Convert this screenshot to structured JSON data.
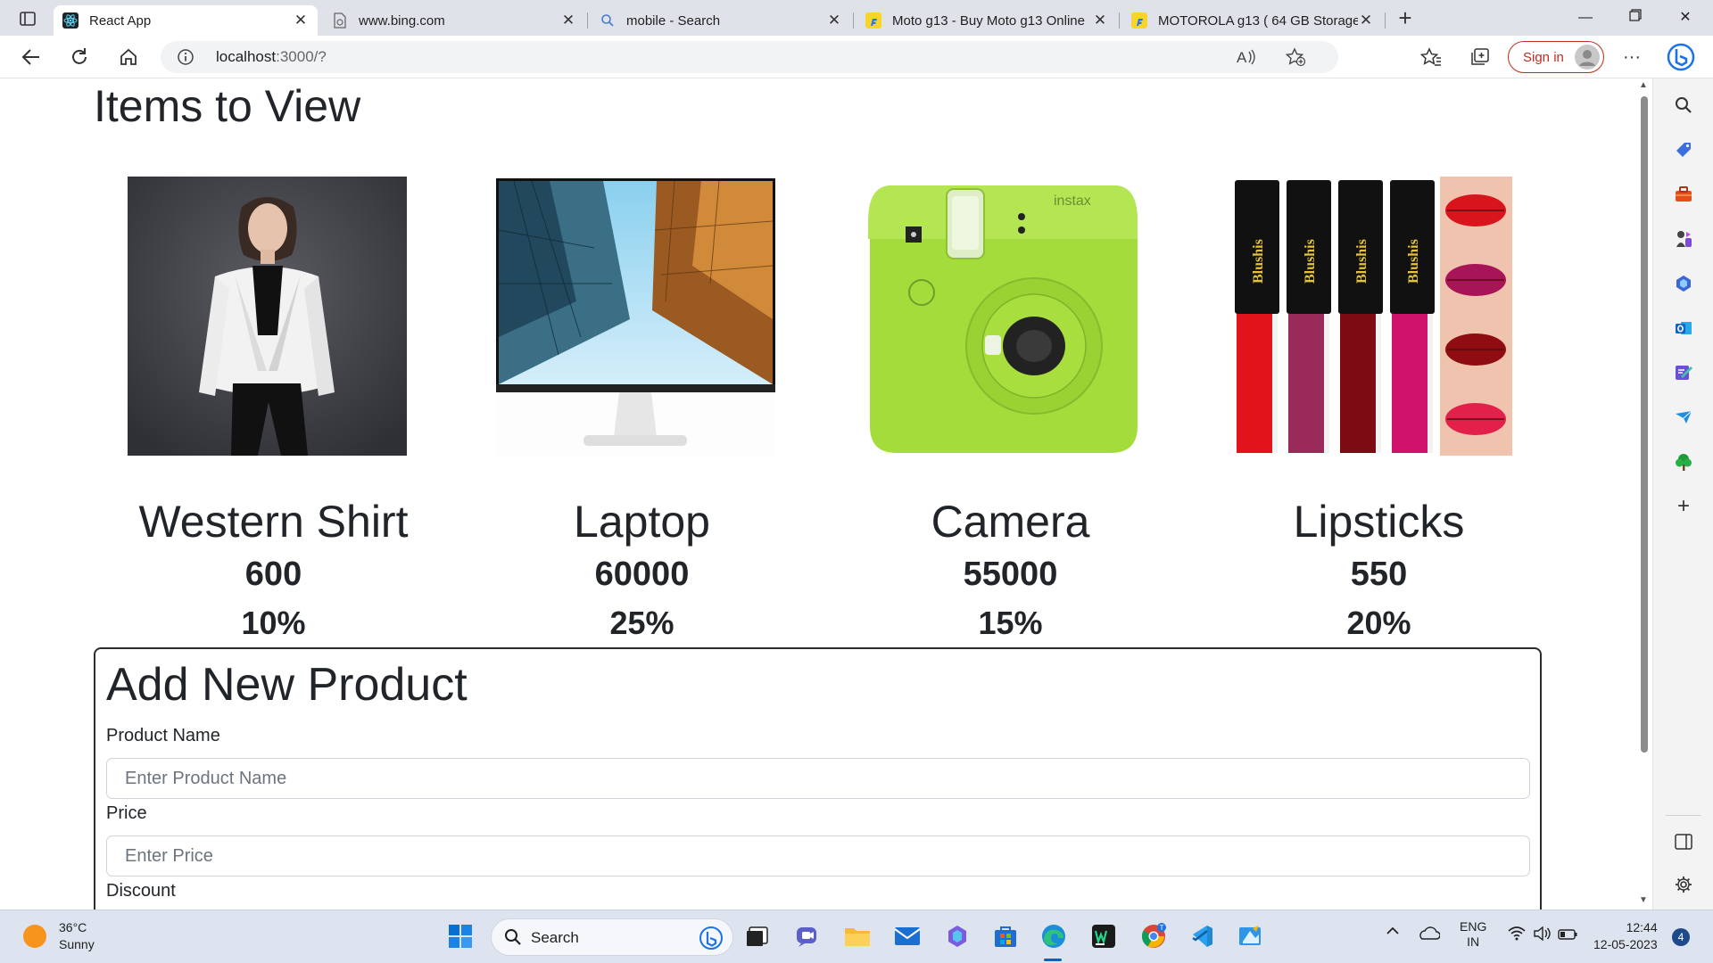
{
  "tabs": [
    {
      "title": "React App",
      "active": true,
      "favicon": "react-icon"
    },
    {
      "title": "www.bing.com",
      "active": false,
      "favicon": "page-icon"
    },
    {
      "title": "mobile - Search",
      "active": false,
      "favicon": "search-icon"
    },
    {
      "title": "Moto g13 - Buy Moto g13 Online",
      "active": false,
      "favicon": "flipkart-icon"
    },
    {
      "title": "MOTOROLA g13 ( 64 GB Storage",
      "active": false,
      "favicon": "flipkart-icon"
    }
  ],
  "address": {
    "host": "localhost",
    "path": ":3000/?"
  },
  "signin_label": "Sign in",
  "page": {
    "title": "Items to View",
    "products": [
      {
        "name": "Western Shirt",
        "price": "600",
        "discount": "10%",
        "image": "white-jacket-model"
      },
      {
        "name": "Laptop",
        "price": "60000",
        "discount": "25%",
        "image": "monitor-skyscrapers"
      },
      {
        "name": "Camera",
        "price": "55000",
        "discount": "15%",
        "image": "green-instax-camera"
      },
      {
        "name": "Lipsticks",
        "price": "550",
        "discount": "20%",
        "image": "lipstick-set"
      }
    ],
    "form": {
      "title": "Add New Product",
      "fields": [
        {
          "label": "Product Name",
          "placeholder": "Enter Product Name"
        },
        {
          "label": "Price",
          "placeholder": "Enter Price"
        },
        {
          "label": "Discount"
        }
      ]
    }
  },
  "taskbar": {
    "weather_temp": "36°C",
    "weather_desc": "Sunny",
    "search_label": "Search",
    "lang_top": "ENG",
    "lang_bottom": "IN",
    "time": "12:44",
    "date": "12-05-2023",
    "notifications": "4"
  },
  "colors": {
    "accent": "#0067c0",
    "signin": "#c42b1c",
    "text": "#212529"
  }
}
